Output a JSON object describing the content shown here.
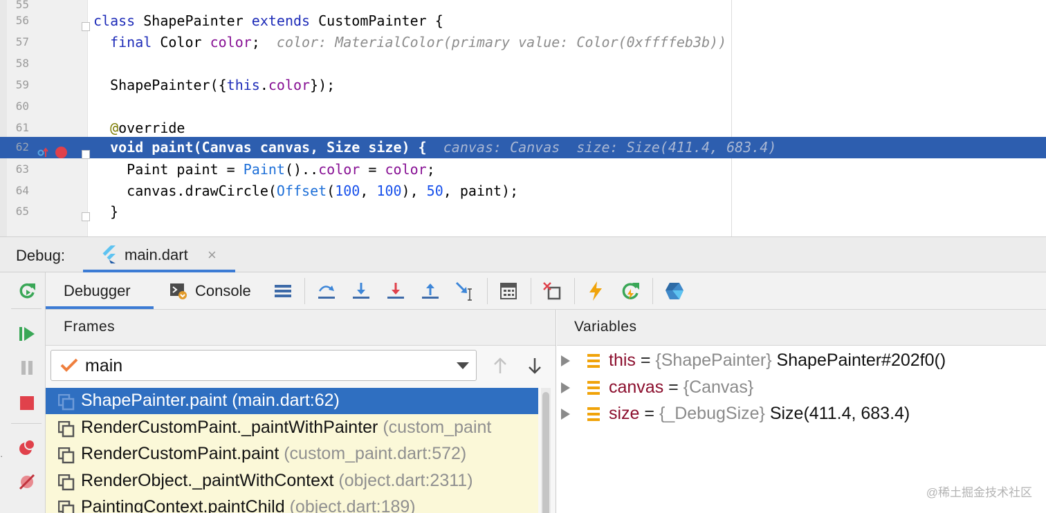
{
  "editor": {
    "lines": [
      {
        "no": "55",
        "segments": []
      },
      {
        "no": "56",
        "segments": [
          {
            "t": "class ",
            "c": "kw"
          },
          {
            "t": "ShapePainter ",
            "c": ""
          },
          {
            "t": "extends ",
            "c": "kw"
          },
          {
            "t": "CustomPainter {",
            "c": ""
          }
        ]
      },
      {
        "no": "57",
        "segments": [
          {
            "t": "  final ",
            "c": "kw"
          },
          {
            "t": "Color ",
            "c": ""
          },
          {
            "t": "color",
            "c": "fld"
          },
          {
            "t": ";  ",
            "c": ""
          },
          {
            "t": "color: MaterialColor(primary value: Color(0xffffeb3b))",
            "c": "hint"
          }
        ]
      },
      {
        "no": "58",
        "segments": []
      },
      {
        "no": "59",
        "segments": [
          {
            "t": "  ShapePainter({",
            "c": ""
          },
          {
            "t": "this",
            "c": "kw"
          },
          {
            "t": ".",
            "c": ""
          },
          {
            "t": "color",
            "c": "fld"
          },
          {
            "t": "});",
            "c": ""
          }
        ]
      },
      {
        "no": "60",
        "segments": []
      },
      {
        "no": "61",
        "segments": [
          {
            "t": "  @",
            "c": "ann"
          },
          {
            "t": "override",
            "c": ""
          }
        ]
      },
      {
        "no": "62",
        "current": true,
        "segments": [
          {
            "t": "  void paint(Canvas canvas, Size size) {  ",
            "c": ""
          },
          {
            "t": "canvas: Canvas  size: Size(411.4, 683.4)",
            "c": "hint"
          }
        ]
      },
      {
        "no": "63",
        "segments": [
          {
            "t": "    Paint paint = ",
            "c": ""
          },
          {
            "t": "Paint",
            "c": "fn"
          },
          {
            "t": "()..",
            "c": ""
          },
          {
            "t": "color",
            "c": "fld"
          },
          {
            "t": " = ",
            "c": ""
          },
          {
            "t": "color",
            "c": "fld"
          },
          {
            "t": ";",
            "c": ""
          }
        ]
      },
      {
        "no": "64",
        "segments": [
          {
            "t": "    canvas.drawCircle(",
            "c": ""
          },
          {
            "t": "Offset",
            "c": "fn"
          },
          {
            "t": "(",
            "c": ""
          },
          {
            "t": "100",
            "c": "num"
          },
          {
            "t": ", ",
            "c": ""
          },
          {
            "t": "100",
            "c": "num"
          },
          {
            "t": "), ",
            "c": ""
          },
          {
            "t": "50",
            "c": "num"
          },
          {
            "t": ", paint);",
            "c": ""
          }
        ]
      },
      {
        "no": "65",
        "segments": [
          {
            "t": "  }",
            "c": ""
          }
        ]
      }
    ]
  },
  "debug_window": {
    "label": "Debug:",
    "run_tab": {
      "label": "main.dart",
      "close": "×",
      "icon": "flutter-icon"
    }
  },
  "tabs": {
    "debugger": "Debugger",
    "console": "Console"
  },
  "toolbar_icons": [
    "show-execution-point-icon",
    "step-over-icon",
    "step-into-icon",
    "force-step-into-icon",
    "step-out-icon",
    "run-to-cursor-icon",
    "evaluate-expression-icon",
    "drop-frame-icon",
    "hot-reload-icon",
    "hot-restart-icon",
    "dart-devtools-icon"
  ],
  "side_toolbar_icons": [
    "rerun-icon",
    "resume-icon",
    "pause-icon",
    "stop-icon",
    "view-breakpoints-icon",
    "mute-breakpoints-icon"
  ],
  "frames": {
    "title": "Frames",
    "thread": "main",
    "rows": [
      {
        "method": "ShapePainter.paint",
        "loc": "(main.dart:62)",
        "selected": true
      },
      {
        "method": "RenderCustomPaint._paintWithPainter",
        "loc": "(custom_paint"
      },
      {
        "method": "RenderCustomPaint.paint",
        "loc": "(custom_paint.dart:572)"
      },
      {
        "method": "RenderObject._paintWithContext",
        "loc": "(object.dart:2311)"
      },
      {
        "method": "PaintingContext.paintChild",
        "loc": "(object.dart:189)"
      }
    ]
  },
  "variables": {
    "title": "Variables",
    "rows": [
      {
        "name": "this",
        "eq": " = ",
        "type": "{ShapePainter}",
        "value": " ShapePainter#202f0()"
      },
      {
        "name": "canvas",
        "eq": " = ",
        "type": "{Canvas}",
        "value": ""
      },
      {
        "name": "size",
        "eq": " = ",
        "type": "{_DebugSize}",
        "value": " Size(411.4, 683.4)"
      }
    ]
  },
  "watermark": "@稀土掘金技术社区",
  "colors": {
    "current_line": "#2d5eaf",
    "selected_frame": "#2f6fc1",
    "frames_bg": "#fbf8d8",
    "accent_tab": "#3c7bd4",
    "breakpoint": "#e0414b",
    "var_name": "#8b0e2d"
  }
}
